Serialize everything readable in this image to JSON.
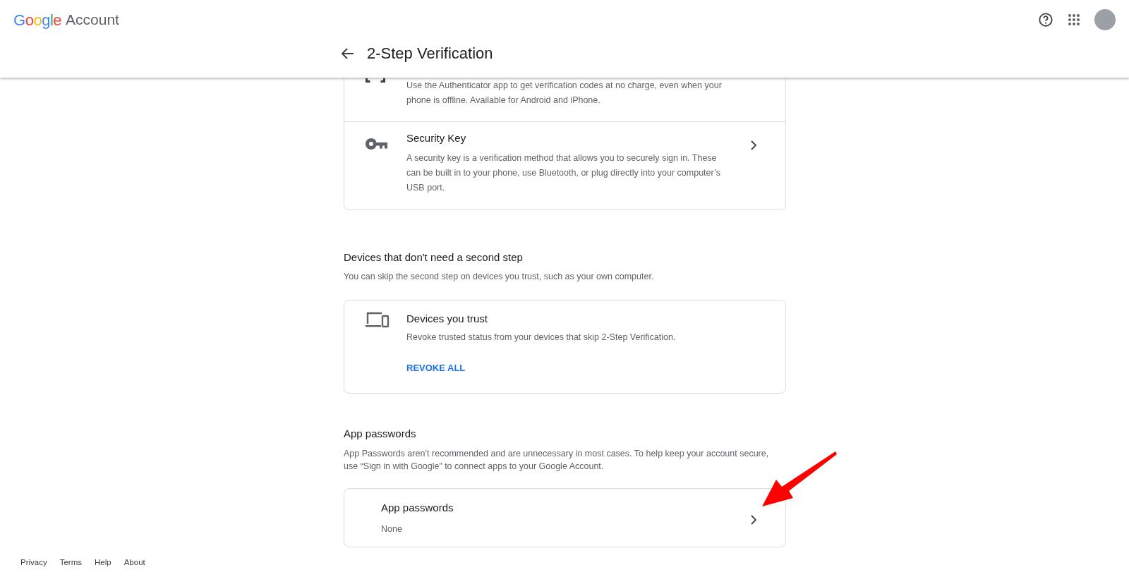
{
  "header": {
    "logo_word": "Google",
    "product": "Account"
  },
  "page_title": "2-Step Verification",
  "methods": [
    {
      "kind": "authenticator",
      "description": "Use the Authenticator app to get verification codes at no charge, even when your phone is offline. Available for Android and iPhone."
    },
    {
      "kind": "key",
      "title": "Security Key",
      "description": "A security key is a verification method that allows you to securely sign in. These can be built in to your phone, use Bluetooth, or plug directly into your computer’s USB port."
    }
  ],
  "trusted_section": {
    "heading": "Devices that don't need a second step",
    "text": "You can skip the second step on devices you trust, such as your own computer.",
    "card_title": "Devices you trust",
    "card_text": "Revoke trusted status from your devices that skip 2-Step Verification.",
    "action": "REVOKE ALL"
  },
  "app_passwords_section": {
    "heading": "App passwords",
    "text": "App Passwords aren’t recommended and are unnecessary in most cases. To help keep your account secure, use “Sign in with Google” to connect apps to your Google Account.",
    "card_title": "App passwords",
    "card_value": "None"
  },
  "footer": [
    "Privacy",
    "Terms",
    "Help",
    "About"
  ]
}
